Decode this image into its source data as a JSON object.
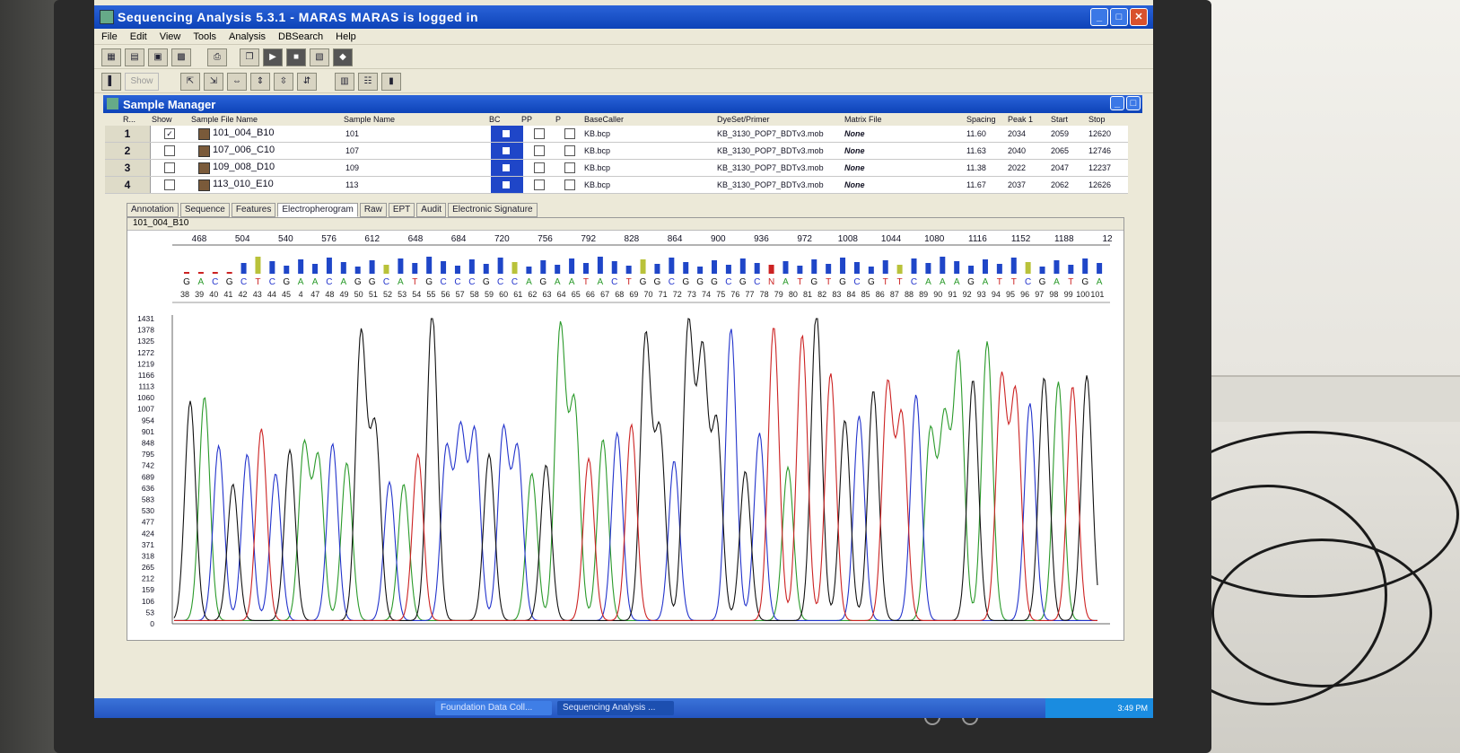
{
  "window": {
    "title": "Sequencing Analysis 5.3.1    -    MARAS MARAS is logged in"
  },
  "menu": [
    "File",
    "Edit",
    "View",
    "Tools",
    "Analysis",
    "DBSearch",
    "Help"
  ],
  "toolbar2": {
    "show_label": "Show"
  },
  "sample_manager": {
    "title": "Sample Manager",
    "columns": [
      "R...",
      "Show",
      "Sample File Name",
      "Sample Name",
      "BC",
      "PP",
      "P",
      "BaseCaller",
      "DyeSet/Primer",
      "Matrix File",
      "Spacing",
      "Peak 1",
      "Start",
      "Stop"
    ],
    "rows": [
      {
        "r": "1",
        "file": "101_004_B10",
        "sample": "101",
        "basecaller": "KB.bcp",
        "dyeset": "KB_3130_POP7_BDTv3.mob",
        "matrix": "None",
        "spacing": "11.60",
        "peak1": "2034",
        "start": "2059",
        "stop": "12620",
        "show": true
      },
      {
        "r": "2",
        "file": "107_006_C10",
        "sample": "107",
        "basecaller": "KB.bcp",
        "dyeset": "KB_3130_POP7_BDTv3.mob",
        "matrix": "None",
        "spacing": "11.63",
        "peak1": "2040",
        "start": "2065",
        "stop": "12746",
        "show": false
      },
      {
        "r": "3",
        "file": "109_008_D10",
        "sample": "109",
        "basecaller": "KB.bcp",
        "dyeset": "KB_3130_POP7_BDTv3.mob",
        "matrix": "None",
        "spacing": "11.38",
        "peak1": "2022",
        "start": "2047",
        "stop": "12237",
        "show": false
      },
      {
        "r": "4",
        "file": "113_010_E10",
        "sample": "113",
        "basecaller": "KB.bcp",
        "dyeset": "KB_3130_POP7_BDTv3.mob",
        "matrix": "None",
        "spacing": "11.67",
        "peak1": "2037",
        "start": "2062",
        "stop": "12626",
        "show": false
      }
    ]
  },
  "tabs": [
    "Annotation",
    "Sequence",
    "Features",
    "Electropherogram",
    "Raw",
    "EPT",
    "Audit",
    "Electronic Signature"
  ],
  "active_tab": "Electropherogram",
  "electropherogram": {
    "sample": "101_004_B10",
    "scan_ticks": [
      "468",
      "504",
      "540",
      "576",
      "612",
      "648",
      "684",
      "720",
      "756",
      "792",
      "828",
      "864",
      "900",
      "936",
      "972",
      "1008",
      "1044",
      "1080",
      "1116",
      "1152",
      "1188",
      "12"
    ],
    "bases": "GACGCTCGAACAGGCATGCCCGCCAGAATACTGGCGGGCGCNATGTGCGTTCAAAGATTCGATGA",
    "position_labels": [
      "38",
      "39",
      "40",
      "41",
      "42",
      "43",
      "44",
      "45",
      "4",
      "47",
      "48",
      "49",
      "50",
      "51",
      "52",
      "53",
      "54",
      "55",
      "56",
      "57",
      "58",
      "59",
      "60",
      "61",
      "62",
      "63",
      "64",
      "65",
      "66",
      "67",
      "68",
      "69",
      "70",
      "71",
      "72",
      "73",
      "74",
      "75",
      "76",
      "77",
      "78",
      "79",
      "80",
      "81",
      "82",
      "83",
      "84",
      "85",
      "86",
      "87",
      "88",
      "89",
      "90",
      "91",
      "92",
      "93",
      "94",
      "95",
      "96",
      "97",
      "98",
      "99",
      "100",
      "101"
    ],
    "y_ticks": [
      "1431",
      "1378",
      "1325",
      "1272",
      "1219",
      "1166",
      "1113",
      "1060",
      "1007",
      "954",
      "901",
      "848",
      "795",
      "742",
      "689",
      "636",
      "583",
      "530",
      "477",
      "424",
      "371",
      "318",
      "265",
      "212",
      "159",
      "106",
      "53",
      "0"
    ],
    "colors": {
      "A": "#2a9a2a",
      "C": "#2233cc",
      "G": "#111111",
      "T": "#cc2222",
      "N": "#cc2222",
      "bar": "#1f46c8"
    }
  },
  "chart_data": {
    "type": "line",
    "title": "",
    "xlabel": "",
    "ylabel": "",
    "ylim": [
      0,
      1431
    ],
    "series_peaks": [
      {
        "base": "G",
        "height": 1030
      },
      {
        "base": "A",
        "height": 1050
      },
      {
        "base": "C",
        "height": 820
      },
      {
        "base": "G",
        "height": 640
      },
      {
        "base": "C",
        "height": 780
      },
      {
        "base": "T",
        "height": 900
      },
      {
        "base": "C",
        "height": 690
      },
      {
        "base": "G",
        "height": 800
      },
      {
        "base": "A",
        "height": 820
      },
      {
        "base": "A",
        "height": 760
      },
      {
        "base": "C",
        "height": 830
      },
      {
        "base": "A",
        "height": 740
      },
      {
        "base": "G",
        "height": 1340
      },
      {
        "base": "G",
        "height": 900
      },
      {
        "base": "C",
        "height": 650
      },
      {
        "base": "A",
        "height": 640
      },
      {
        "base": "T",
        "height": 780
      },
      {
        "base": "G",
        "height": 1450
      },
      {
        "base": "C",
        "height": 800
      },
      {
        "base": "C",
        "height": 880
      },
      {
        "base": "C",
        "height": 880
      },
      {
        "base": "G",
        "height": 780
      },
      {
        "base": "C",
        "height": 890
      },
      {
        "base": "C",
        "height": 800
      },
      {
        "base": "A",
        "height": 690
      },
      {
        "base": "G",
        "height": 730
      },
      {
        "base": "A",
        "height": 1370
      },
      {
        "base": "A",
        "height": 1010
      },
      {
        "base": "T",
        "height": 760
      },
      {
        "base": "A",
        "height": 850
      },
      {
        "base": "C",
        "height": 880
      },
      {
        "base": "T",
        "height": 920
      },
      {
        "base": "G",
        "height": 1330
      },
      {
        "base": "G",
        "height": 880
      },
      {
        "base": "C",
        "height": 750
      },
      {
        "base": "G",
        "height": 1380
      },
      {
        "base": "G",
        "height": 1240
      },
      {
        "base": "G",
        "height": 920
      },
      {
        "base": "C",
        "height": 1370
      },
      {
        "base": "G",
        "height": 700
      },
      {
        "base": "C",
        "height": 880
      },
      {
        "base": "N",
        "height": 1380
      },
      {
        "base": "A",
        "height": 720
      },
      {
        "base": "T",
        "height": 1340
      },
      {
        "base": "G",
        "height": 1450
      },
      {
        "base": "T",
        "height": 1160
      },
      {
        "base": "G",
        "height": 940
      },
      {
        "base": "C",
        "height": 960
      },
      {
        "base": "G",
        "height": 1080
      },
      {
        "base": "T",
        "height": 1100
      },
      {
        "base": "T",
        "height": 950
      },
      {
        "base": "C",
        "height": 1060
      },
      {
        "base": "A",
        "height": 880
      },
      {
        "base": "A",
        "height": 930
      },
      {
        "base": "A",
        "height": 1240
      },
      {
        "base": "G",
        "height": 1130
      },
      {
        "base": "A",
        "height": 1310
      },
      {
        "base": "T",
        "height": 1130
      },
      {
        "base": "T",
        "height": 1060
      },
      {
        "base": "C",
        "height": 1020
      },
      {
        "base": "G",
        "height": 1140
      },
      {
        "base": "A",
        "height": 1120
      },
      {
        "base": "T",
        "height": 1100
      },
      {
        "base": "G",
        "height": 1150
      }
    ]
  },
  "taskbar": {
    "item1": "Foundation Data Coll...",
    "item2": "Sequencing Analysis ...",
    "clock": "3:49 PM"
  }
}
